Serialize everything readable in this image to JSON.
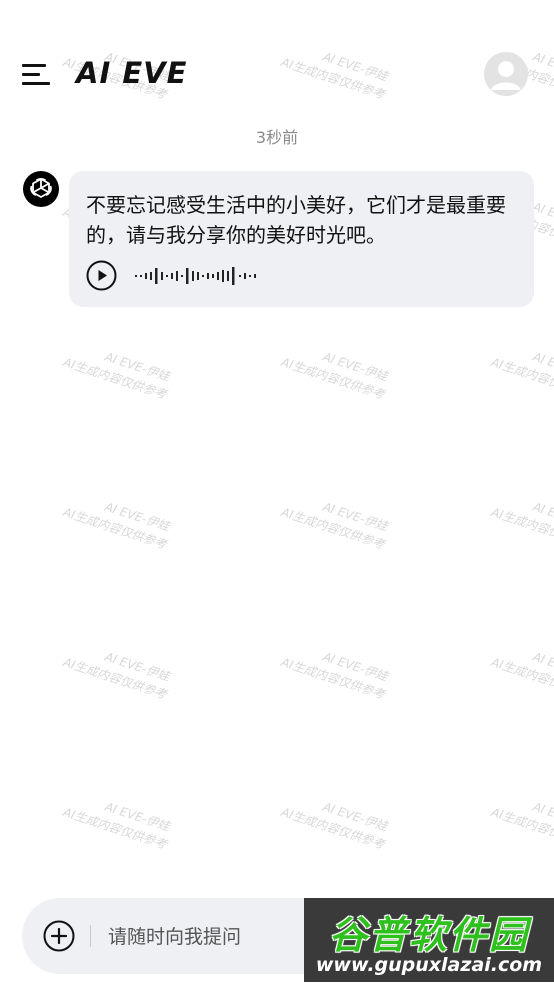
{
  "header": {
    "title": "AI EVE"
  },
  "conversation": {
    "timestamp": "3秒前",
    "messages": [
      {
        "sender": "assistant",
        "text": "不要忘记感受生活中的小美好，它们才是最重要的，请与我分享你的美好时光吧。"
      }
    ]
  },
  "composer": {
    "placeholder": "请随时向我提问"
  },
  "watermark": {
    "line1": "AI EVE-伊娃",
    "line2": "AI生成内容仅供参考"
  },
  "site_logo": {
    "title": "谷普软件园",
    "url": "www.gupuxlazai.com"
  },
  "icons": {
    "menu": "menu-icon",
    "avatar": "user-avatar-icon",
    "bot": "openai-logo-icon",
    "play": "play-icon",
    "add": "plus-circle-icon",
    "send": "send-icon"
  },
  "colors": {
    "bubble_bg": "#eef0f4",
    "timestamp": "#8a8a8a",
    "watermark": "#d8d8d8",
    "logo_green": "#2ec11e"
  }
}
